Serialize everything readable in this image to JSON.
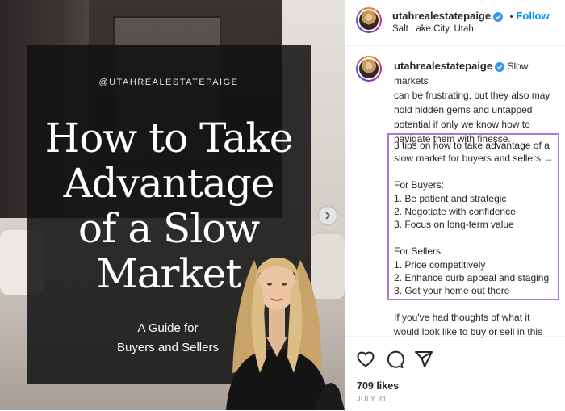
{
  "post_image": {
    "handle": "@UTAHREALESTATEPAIGE",
    "headline": [
      "How to Take",
      "Advantage",
      "of a Slow",
      "Market"
    ],
    "subhead": [
      "A Guide for",
      "Buyers and Sellers"
    ]
  },
  "header": {
    "username": "utahrealestatepaige",
    "separator": "•",
    "follow_label": "Follow",
    "location": "Salt Lake City, Utah"
  },
  "caption": {
    "username": "utahrealestatepaige",
    "lines": [
      "Slow markets",
      "can be frustrating, but they also may",
      "hold hidden gems and untapped",
      "potential if only we know how to",
      "navigate them with finesse."
    ],
    "tips": [
      "3 tips on how to take advantage of a",
      "slow market for buyers and sellers →",
      "",
      "For Buyers:",
      "1. Be patient and strategic",
      "2. Negotiate with confidence",
      "3. Focus on long-term value",
      "",
      "For Sellers:",
      "1. Price competitively",
      "2. Enhance curb appeal and staging",
      "3. Get your home out there"
    ],
    "more": [
      "If you've had thoughts of what it",
      "would look like to buy or sell in this"
    ]
  },
  "footer": {
    "likes": "709 likes",
    "date": "JULY 31"
  },
  "colors": {
    "accent_blue": "#0095f6",
    "verified_blue": "#3897f0",
    "tips_border": "#a77ad9"
  },
  "icons": {
    "like": "heart-icon",
    "comment": "comment-icon",
    "share": "share-icon",
    "next": "chevron-right-icon"
  }
}
